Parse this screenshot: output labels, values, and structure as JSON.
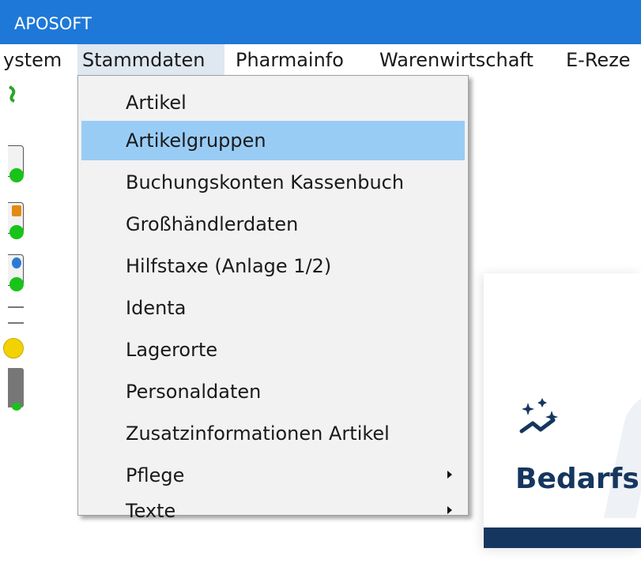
{
  "window": {
    "title": "APOSOFT",
    "accent_color": "#1e78d8"
  },
  "menubar": {
    "items": [
      {
        "label": "ystem"
      },
      {
        "label": "Stammdaten",
        "active": true
      },
      {
        "label": "Pharmainfo"
      },
      {
        "label": "Warenwirtschaft"
      },
      {
        "label": "E-Reze"
      }
    ]
  },
  "toolbar": {
    "icons": [
      "document-green-icon",
      "document-orange-icon",
      "document-globe-icon",
      "printer-icon",
      "yellow-status-icon",
      "pledge-icon"
    ]
  },
  "dropdown": {
    "items": [
      {
        "label": "Artikel"
      },
      {
        "label": "Artikelgruppen",
        "highlighted": true
      },
      {
        "label": "Buchungskonten Kassenbuch"
      },
      {
        "label": "Großhändlerdaten"
      },
      {
        "label": "Hilfstaxe (Anlage 1/2)"
      },
      {
        "label": "Identa"
      },
      {
        "label": "Lagerorte"
      },
      {
        "label": "Personaldaten"
      },
      {
        "label": "Zusatzinformationen Artikel"
      },
      {
        "label": "Pflege",
        "submenu": true
      },
      {
        "label": "Texte",
        "submenu": true
      }
    ],
    "highlight_color": "#99ccf5"
  },
  "panel": {
    "brand": "Bedarfs",
    "icon": "sparkle-trend-icon",
    "brand_color": "#15365f"
  }
}
